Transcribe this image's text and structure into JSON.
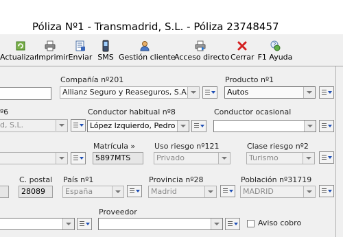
{
  "window": {
    "title": "Póliza Nº1 - Transmadrid, S.L. - Póliza 23748457"
  },
  "toolbar": {
    "buttons": [
      {
        "label": "Actualizar",
        "icon": "refresh-icon"
      },
      {
        "label": "Imprimir",
        "icon": "printer-icon"
      },
      {
        "label": "Enviar",
        "icon": "send-document-icon"
      },
      {
        "label": "SMS",
        "icon": "sms-phone-icon"
      },
      {
        "label": "Gestión cliente",
        "icon": "client-management-icon"
      },
      {
        "label": "Acceso directo",
        "icon": "shortcut-printer-icon"
      },
      {
        "label": "Cerrar",
        "icon": "close-icon"
      },
      {
        "label": "F1 Ayuda",
        "icon": "help-icon"
      }
    ]
  },
  "form": {
    "compania": {
      "label": "Compañía nº201",
      "value": "Allianz Seguro y Reaseguros, S.A."
    },
    "producto": {
      "label": "Producto nº1",
      "value": "Autos"
    },
    "tomador": {
      "label": "º6",
      "value": "d, S.L."
    },
    "conductor_habitual": {
      "label": "Conductor habitual nº8",
      "value": "López Izquierdo, Pedro"
    },
    "conductor_ocasional": {
      "label": "Conductor ocasional",
      "value": ""
    },
    "matricula": {
      "label": "Matrícula »",
      "value": "5897MTS"
    },
    "uso_riesgo": {
      "label": "Uso riesgo nº121",
      "value": "Privado"
    },
    "clase_riesgo": {
      "label": "Clase riesgo nº2",
      "value": "Turismo"
    },
    "codigo_postal": {
      "label": "C. postal",
      "value": "28089"
    },
    "pais": {
      "label": "País nº1",
      "value": "España"
    },
    "provincia": {
      "label": "Provincia nº28",
      "value": "Madrid"
    },
    "poblacion": {
      "label": "Población nº31719",
      "value": "MADRID"
    },
    "proveedor": {
      "label": "Proveedor",
      "value": ""
    },
    "aviso_cobro": {
      "label": "Aviso cobro",
      "checked": false
    }
  },
  "colors": {
    "close_icon": "#d42020",
    "list_arrow": "#1f4fb5",
    "disabled_text": "#8a8a8a"
  }
}
